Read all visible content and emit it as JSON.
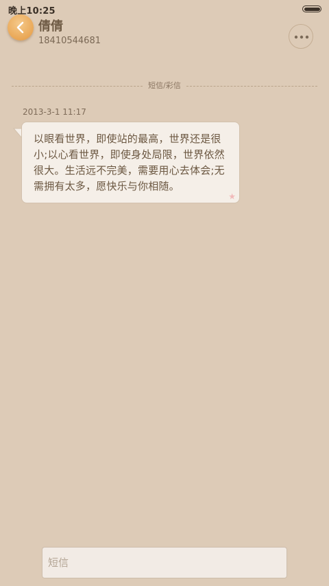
{
  "status_bar": {
    "time": "晚上10:25",
    "battery_icon": "battery-icon"
  },
  "header": {
    "back_icon": "chevron-left-icon",
    "contact_name": "倩倩",
    "contact_number": "18410544681",
    "more_icon": "more-dots-icon"
  },
  "divider": {
    "label": "短信/彩信"
  },
  "messages": [
    {
      "timestamp": "2013-3-1 11:17",
      "text": "以眼看世界，即使站的最高，世界还是很小;以心看世界，即使身处局限，世界依然很大。生活远不完美，需要用心去体会;无需拥有太多，愿快乐与你相随。",
      "starred": true
    }
  ],
  "composer": {
    "placeholder": "短信"
  },
  "colors": {
    "background": "#ddcbb7",
    "accent": "#e9a756",
    "bubble": "#f5efe8",
    "star": "#f1b9b9"
  }
}
